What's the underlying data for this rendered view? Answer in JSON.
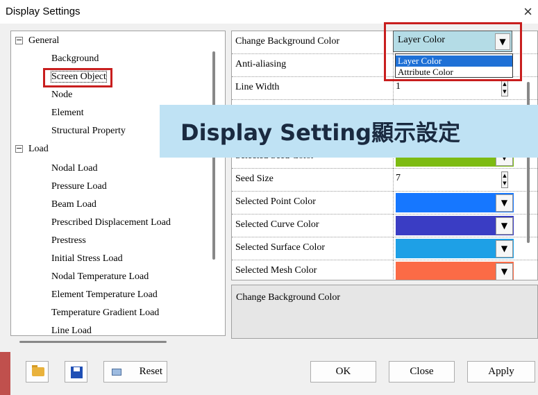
{
  "window": {
    "title": "Display Settings",
    "close_glyph": "×"
  },
  "tree": {
    "group_general": "General",
    "general_items": [
      "Background",
      "Screen Object",
      "Node",
      "Element",
      "Structural Property"
    ],
    "group_load": "Load",
    "load_items": [
      "Nodal Load",
      "Pressure Load",
      "Beam Load",
      "Prescribed Displacement Load",
      "Prestress",
      "Initial Stress Load",
      "Nodal Temperature Load",
      "Element Temperature Load",
      "Temperature Gradient Load",
      "Line Load"
    ],
    "selected_item": "Screen Object"
  },
  "grid": {
    "rows": [
      {
        "name": "Change Background Color",
        "value": "Layer Color"
      },
      {
        "name": "Anti-aliasing",
        "value": ""
      },
      {
        "name": "Line Width",
        "value": "1"
      },
      {
        "name": "",
        "value": ""
      },
      {
        "name": "",
        "value": ""
      },
      {
        "name": "Selected Seed Color",
        "value": "#7dbb12"
      },
      {
        "name": "Seed Size",
        "value": "7"
      },
      {
        "name": "Selected Point Color",
        "value": "#1677ff"
      },
      {
        "name": "Selected Curve Color",
        "value": "#3a3dc4"
      },
      {
        "name": "Selected Surface Color",
        "value": "#1ea0e6"
      },
      {
        "name": "Selected Mesh Color",
        "value": "#fb6b46"
      }
    ],
    "dropdown_options": [
      "Layer Color",
      "Attribute Color"
    ],
    "spin_up": "▲",
    "spin_down": "▼",
    "dropdown_arrow": "▼"
  },
  "banner": {
    "text": "Display Setting顯示設定"
  },
  "description": {
    "text": "Change Background Color"
  },
  "buttons": {
    "reset": "Reset",
    "ok": "OK",
    "close": "Close",
    "apply": "Apply"
  },
  "icons": {
    "open": "folder-open-icon",
    "save": "floppy-disk-icon",
    "reset": "reset-icon"
  },
  "colors": {
    "highlight": "#c81e1e",
    "selection": "#1e70d6",
    "banner": "#bfe2f4"
  }
}
